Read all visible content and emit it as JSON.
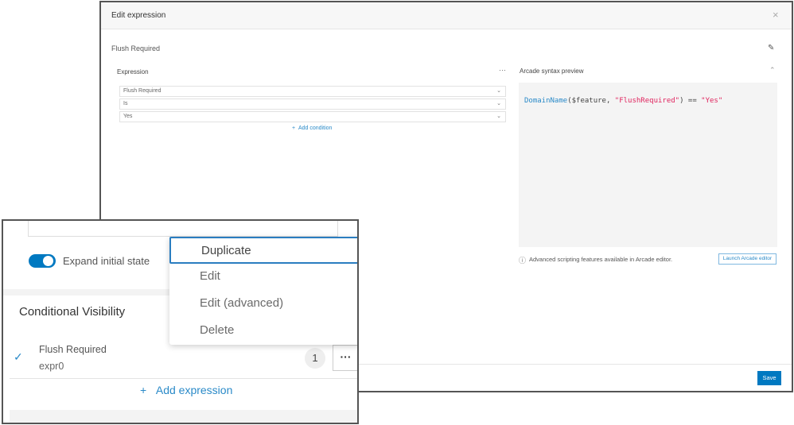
{
  "dialog": {
    "title": "Edit expression",
    "expression_name": "Flush Required",
    "expression_panel": {
      "label": "Expression",
      "conditions": [
        {
          "value": "Flush Required"
        },
        {
          "value": "Is"
        },
        {
          "value": "Yes"
        }
      ],
      "add_condition": "Add condition"
    },
    "preview": {
      "label": "Arcade syntax preview",
      "code_fn": "DomainName",
      "code_args": "($feature, ",
      "code_str1": "\"FlushRequired\"",
      "code_op": ") == ",
      "code_str2": "\"Yes\"",
      "help_text": "Advanced scripting features available in Arcade editor.",
      "launch_button": "Launch Arcade editor"
    },
    "save": "Save"
  },
  "inset": {
    "toggle_label": "Expand initial state",
    "toggle_on": true,
    "section_title": "Conditional Visibility",
    "item": {
      "title": "Flush Required",
      "subtitle": "expr0",
      "count": "1"
    },
    "add_expression": "Add expression",
    "menu": [
      "Duplicate",
      "Edit",
      "Edit (advanced)",
      "Delete"
    ]
  },
  "colors": {
    "accent": "#0079c1",
    "string": "#e0245e",
    "fn": "#2a8ac8"
  }
}
